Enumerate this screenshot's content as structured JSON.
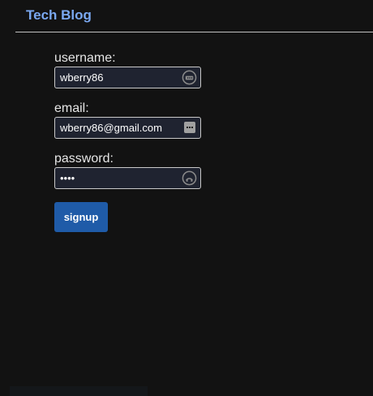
{
  "header": {
    "brand": "Tech Blog"
  },
  "form": {
    "username": {
      "label": "username:",
      "value": "wberry86",
      "icon": "password-manager-icon"
    },
    "email": {
      "label": "email:",
      "value": "wberry86@gmail.com",
      "icon": "autofill-icon"
    },
    "password": {
      "label": "password:",
      "value": "wbe1",
      "icon": "password-manager-icon"
    },
    "submit_label": "signup"
  },
  "colors": {
    "background": "#121212",
    "brand": "#7aa8f0",
    "button": "#1f5ba8",
    "input_bg": "#1f2330"
  }
}
